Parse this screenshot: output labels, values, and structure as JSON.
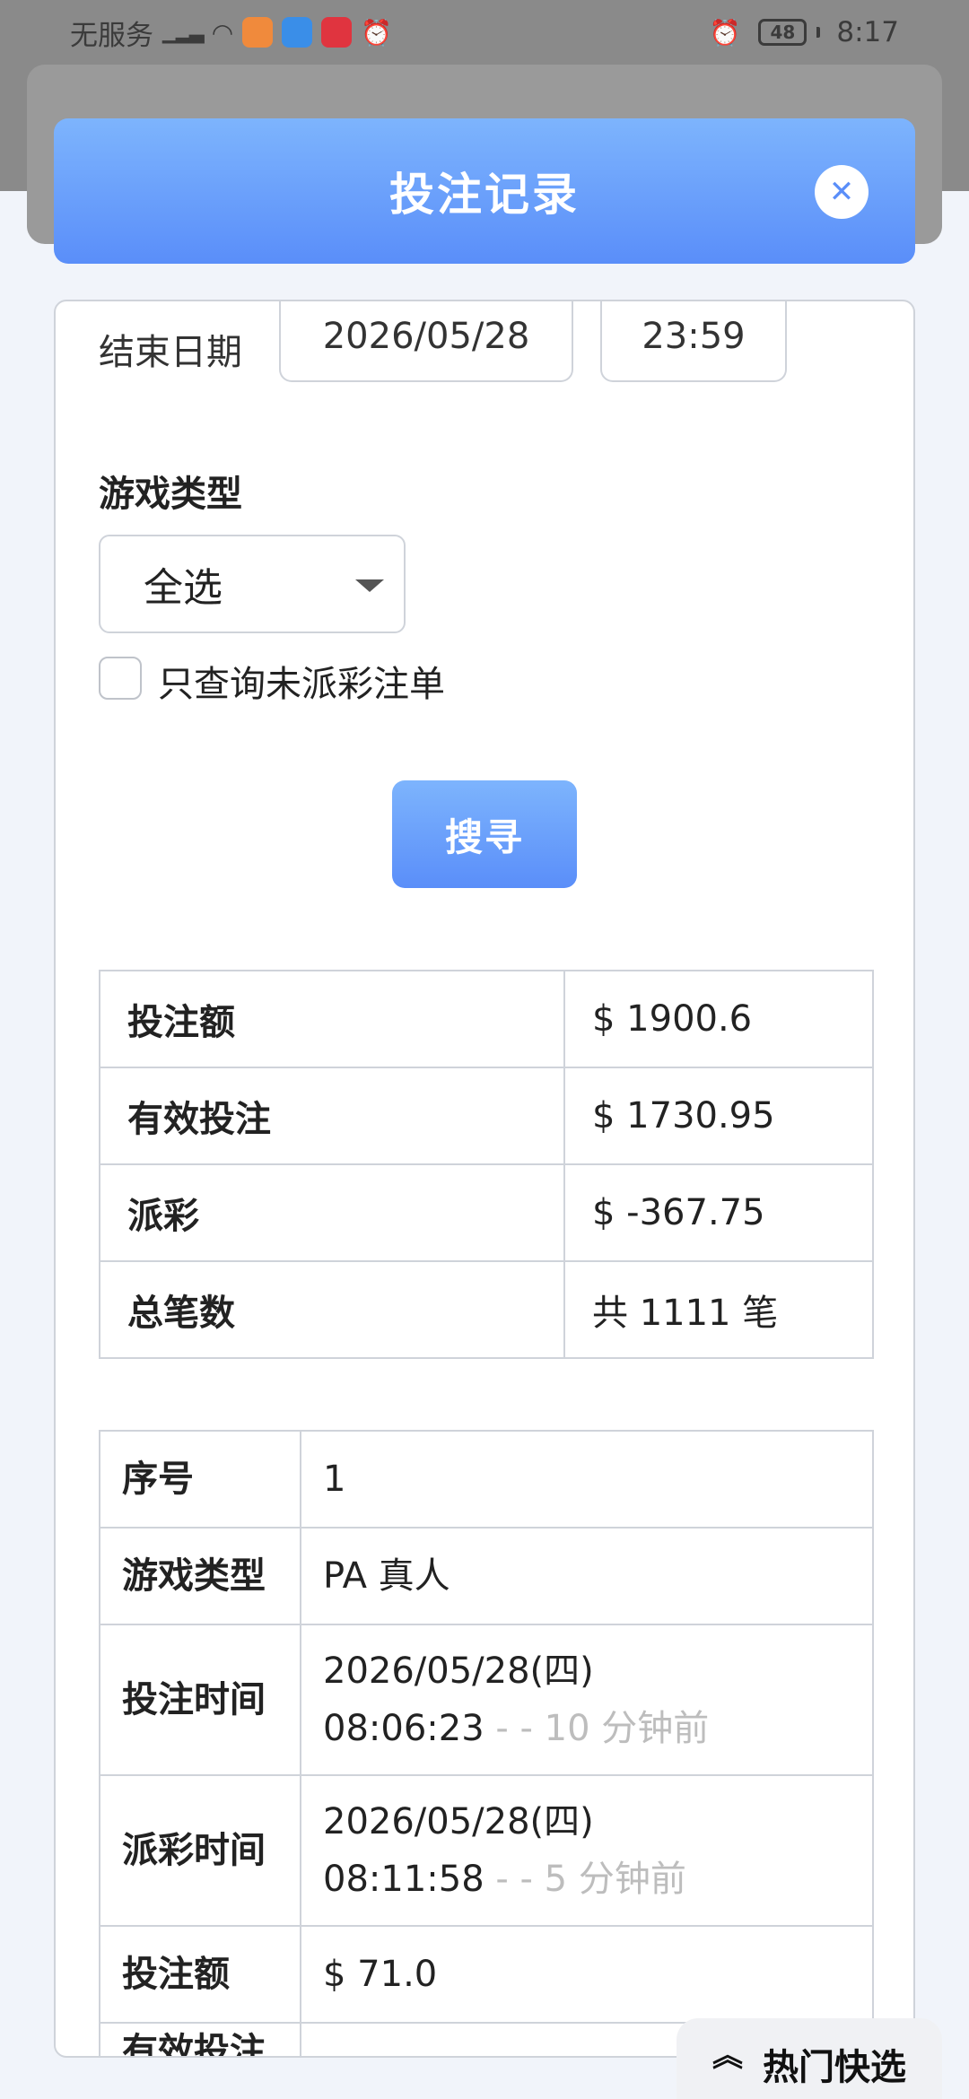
{
  "status_bar": {
    "carrier": "无服务",
    "time": "8:17",
    "battery": "48"
  },
  "modal": {
    "title": "投注记录"
  },
  "filters": {
    "end_date_label": "结束日期",
    "end_date": "2026/05/28",
    "end_time": "23:59",
    "game_type_label": "游戏类型",
    "game_type_selected": "全选",
    "unsettled_only_label": "只查询未派彩注单",
    "search_label": "搜寻"
  },
  "summary": [
    {
      "label": "投注额",
      "value": "$ 1900.6"
    },
    {
      "label": "有效投注",
      "value": "$ 1730.95"
    },
    {
      "label": "派彩",
      "value": "$ -367.75"
    },
    {
      "label": "总笔数",
      "value": "共 1111 笔"
    }
  ],
  "record": {
    "index_label": "序号",
    "index_value": "1",
    "game_type_label": "游戏类型",
    "game_type_value": "PA 真人",
    "bet_time_label": "投注时间",
    "bet_time_date": "2026/05/28(四)",
    "bet_time_clock": "08:06:23",
    "bet_time_ago": " -  - 10 分钟前",
    "payout_time_label": "派彩时间",
    "payout_time_date": "2026/05/28(四)",
    "payout_time_clock": "08:11:58",
    "payout_time_ago": " -  - 5 分钟前",
    "bet_amount_label": "投注额",
    "bet_amount_value": "$ 71.0",
    "valid_bet_label": "有效投注"
  },
  "quick_select": {
    "label": "热门快选"
  }
}
